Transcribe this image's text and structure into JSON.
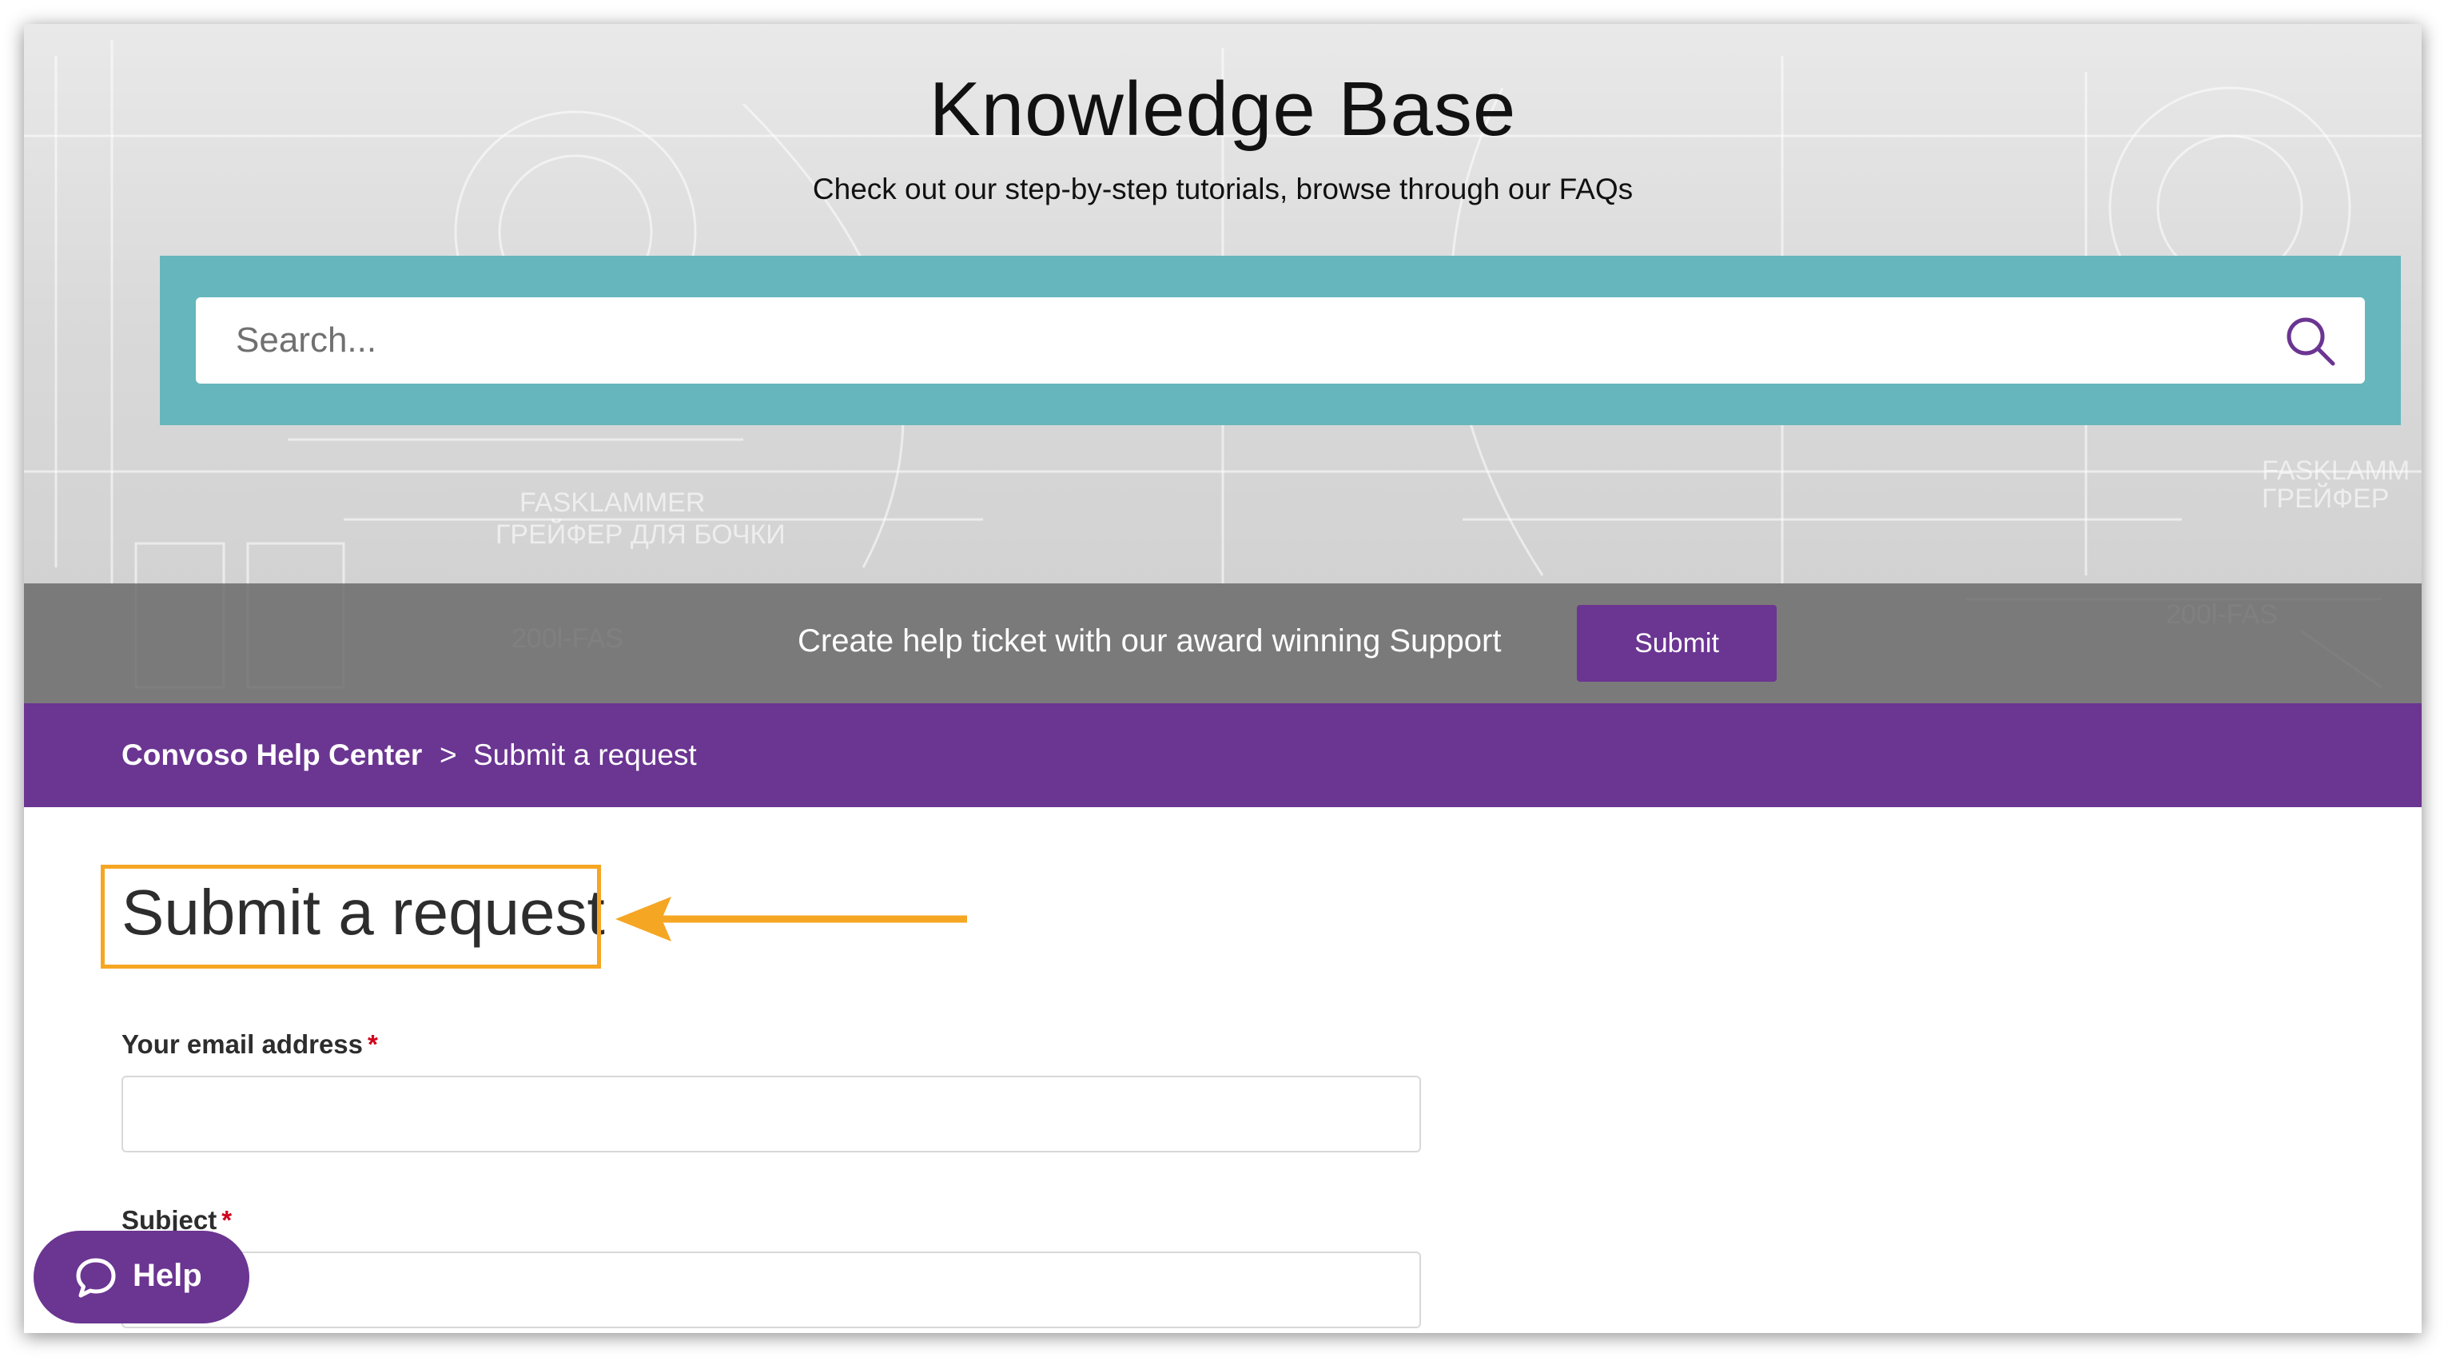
{
  "hero": {
    "title": "Knowledge Base",
    "subtitle": "Check out our step-by-step tutorials, browse through our FAQs"
  },
  "search": {
    "placeholder": "Search..."
  },
  "support_bar": {
    "text": "Create help ticket with our award winning Support",
    "button_label": "Submit"
  },
  "breadcrumb": {
    "home": "Convoso Help Center",
    "separator": ">",
    "current": "Submit a request"
  },
  "form": {
    "title": "Submit a request",
    "fields": [
      {
        "label": "Your email address",
        "required_mark": "*",
        "value": ""
      },
      {
        "label": "Subject",
        "required_mark": "*",
        "value": ""
      }
    ]
  },
  "help_widget": {
    "label": "Help"
  },
  "colors": {
    "brand_purple": "#6b3592",
    "search_band_teal": "#66b6bd",
    "annotation_orange": "#f5a623",
    "required_red": "#d0021b"
  },
  "icons": [
    "search-icon",
    "arrow-annotation-icon",
    "chat-bubble-icon"
  ]
}
